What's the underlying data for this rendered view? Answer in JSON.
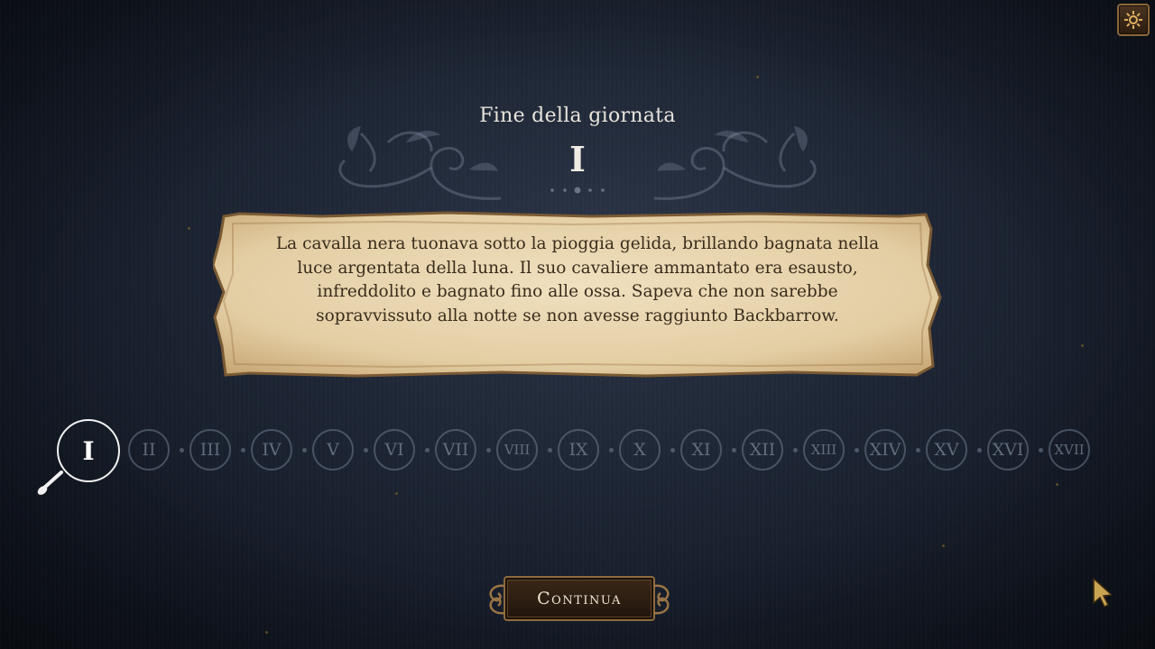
{
  "header": {
    "title": "Fine della giornata",
    "day_numeral": "I"
  },
  "story": {
    "text": "La cavalla nera tuonava sotto la pioggia gelida, brillando bagnata nella luce argentata della luna. Il suo cavaliere ammantato era esausto, infreddolito e bagnato fino alle ossa. Sapeva che non sarebbe sopravvissuto alla notte se non avesse raggiunto Backbarrow."
  },
  "chapters": {
    "active": "I",
    "items": [
      "II",
      "III",
      "IV",
      "V",
      "VI",
      "VII",
      "VIII",
      "IX",
      "X",
      "XI",
      "XII",
      "XIII",
      "XIV",
      "XV",
      "XVI",
      "XVII"
    ]
  },
  "buttons": {
    "continue_label": "Continua"
  },
  "icons": {
    "settings": "gear-icon",
    "magnifier": "magnifier-icon",
    "cursor": "pointer-cursor-icon"
  },
  "colors": {
    "background": "#1c2433",
    "parchment": "#e8d3ac",
    "accent_gold": "#8e6a3c",
    "active_ring": "#f2f2f2"
  }
}
